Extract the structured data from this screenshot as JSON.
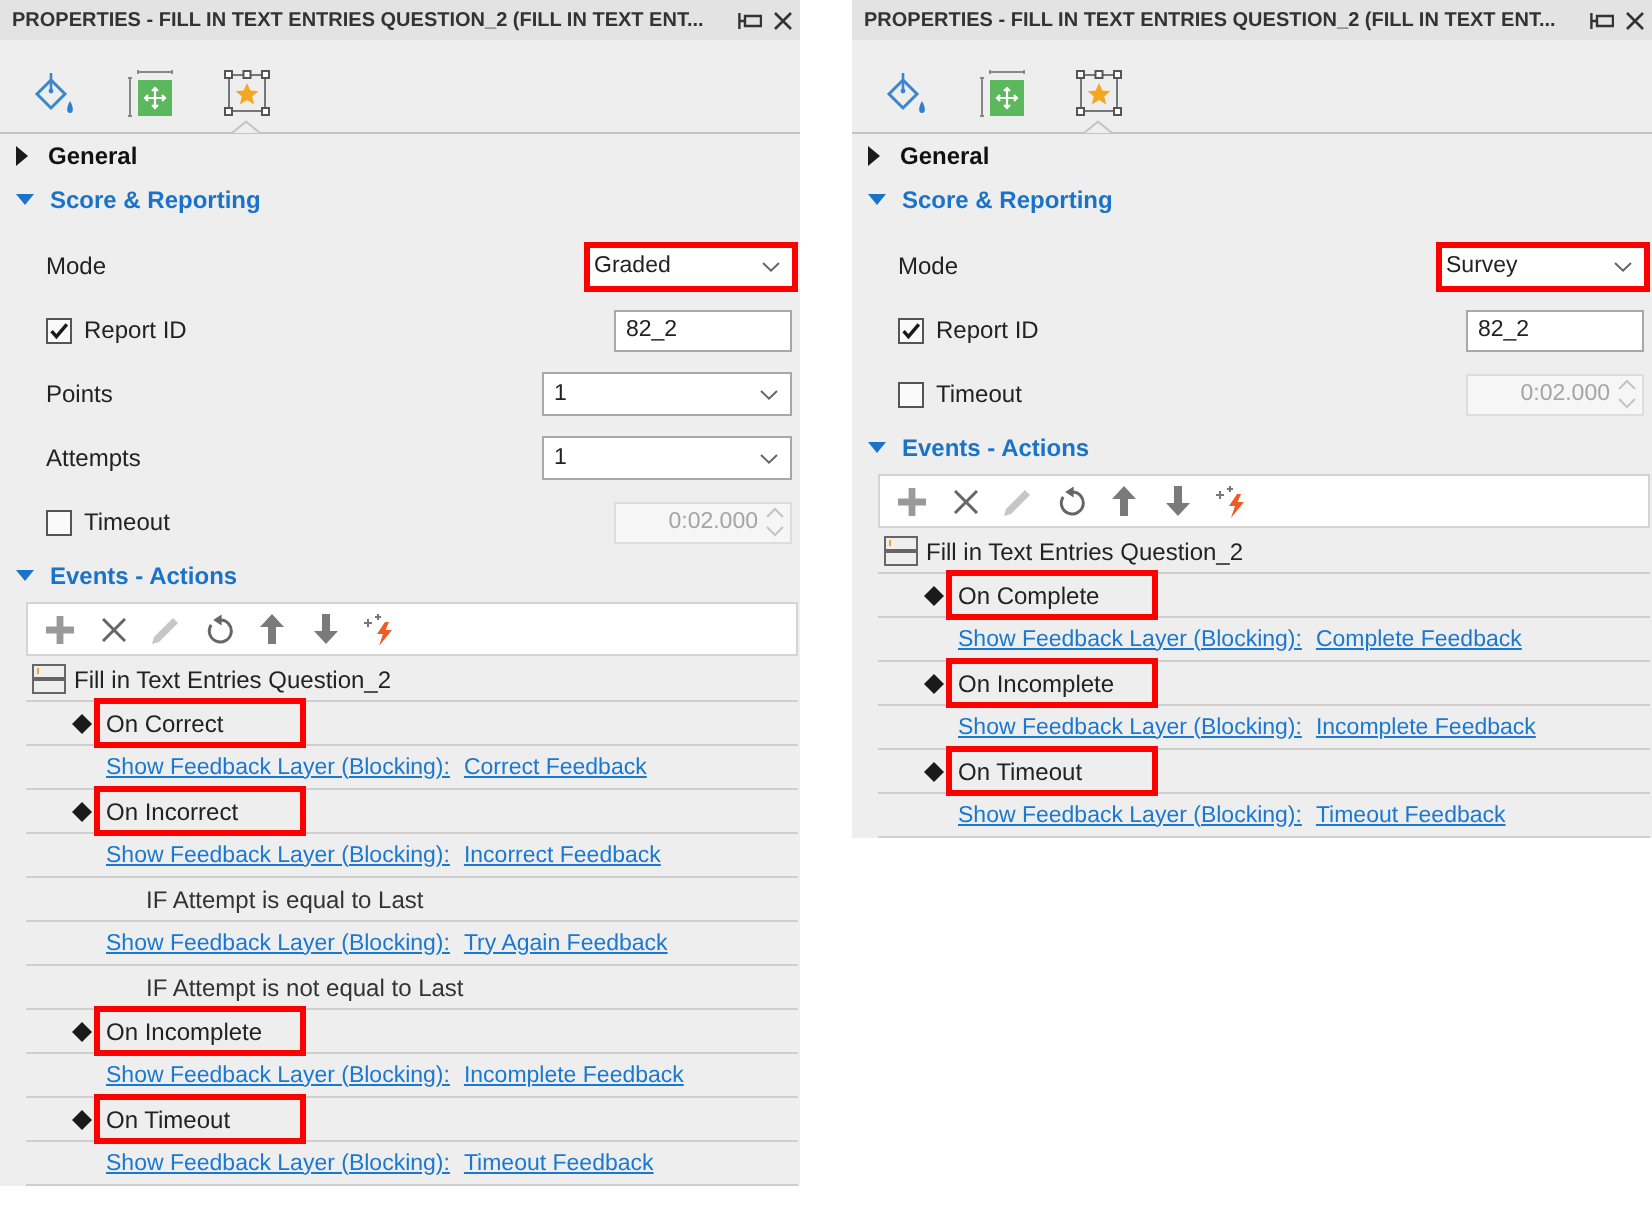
{
  "panels": [
    {
      "title": "PROPERTIES - FILL IN TEXT ENTRIES QUESTION_2 (FILL IN TEXT ENT...",
      "tabs": [
        {
          "kind": "fill",
          "selected": false
        },
        {
          "kind": "position",
          "selected": false
        },
        {
          "kind": "interaction",
          "selected": true
        }
      ],
      "sections": [
        {
          "title": "General",
          "expanded": false
        },
        {
          "title": "Score & Reporting",
          "expanded": true,
          "fields": [
            {
              "kind": "select",
              "label": "Mode",
              "value": "Graded",
              "highlighted": true
            },
            {
              "kind": "text",
              "label": "Report ID",
              "checked": true,
              "value": "82_2"
            },
            {
              "kind": "select",
              "label": "Points",
              "value": "1",
              "highlighted": false
            },
            {
              "kind": "select",
              "label": "Attempts",
              "value": "1",
              "highlighted": false
            },
            {
              "kind": "spinner",
              "label": "Timeout",
              "checked": false,
              "value": "0:02.000",
              "disabled": true
            }
          ]
        },
        {
          "title": "Events - Actions",
          "expanded": true,
          "toolbar": [
            {
              "kind": "add",
              "disabled": false
            },
            {
              "kind": "delete",
              "disabled": false
            },
            {
              "kind": "edit",
              "disabled": true
            },
            {
              "kind": "reset",
              "disabled": false
            },
            {
              "kind": "up",
              "disabled": false
            },
            {
              "kind": "down",
              "disabled": false
            },
            {
              "kind": "trigger",
              "disabled": false
            }
          ],
          "tree": {
            "label": "Fill in Text Entries Question_2",
            "children": [
              {
                "kind": "event",
                "label": "On Correct",
                "highlighted": true,
                "children": [
                  {
                    "kind": "action",
                    "action": "Show Feedback Layer (Blocking):",
                    "target": "Correct Feedback"
                  }
                ]
              },
              {
                "kind": "event",
                "label": "On Incorrect",
                "highlighted": true,
                "children": [
                  {
                    "kind": "action",
                    "action": "Show Feedback Layer (Blocking):",
                    "target": "Incorrect Feedback",
                    "children": [
                      {
                        "kind": "condition",
                        "label": "IF Attempt is equal to Last"
                      }
                    ]
                  },
                  {
                    "kind": "action",
                    "action": "Show Feedback Layer (Blocking):",
                    "target": "Try Again Feedback",
                    "children": [
                      {
                        "kind": "condition",
                        "label": "IF Attempt is not equal to Last"
                      }
                    ]
                  }
                ]
              },
              {
                "kind": "event",
                "label": "On Incomplete",
                "highlighted": true,
                "children": [
                  {
                    "kind": "action",
                    "action": "Show Feedback Layer (Blocking):",
                    "target": "Incomplete Feedback"
                  }
                ]
              },
              {
                "kind": "event",
                "label": "On Timeout",
                "highlighted": true,
                "children": [
                  {
                    "kind": "action",
                    "action": "Show Feedback Layer (Blocking):",
                    "target": "Timeout Feedback"
                  }
                ]
              }
            ]
          }
        }
      ]
    },
    {
      "title": "PROPERTIES - FILL IN TEXT ENTRIES QUESTION_2 (FILL IN TEXT ENT...",
      "tabs": [
        {
          "kind": "fill",
          "selected": false
        },
        {
          "kind": "position",
          "selected": false
        },
        {
          "kind": "interaction",
          "selected": true
        }
      ],
      "sections": [
        {
          "title": "General",
          "expanded": false
        },
        {
          "title": "Score & Reporting",
          "expanded": true,
          "fields": [
            {
              "kind": "select",
              "label": "Mode",
              "value": "Survey",
              "highlighted": true
            },
            {
              "kind": "text",
              "label": "Report ID",
              "checked": true,
              "value": "82_2"
            },
            {
              "kind": "spinner",
              "label": "Timeout",
              "checked": false,
              "value": "0:02.000",
              "disabled": true
            }
          ]
        },
        {
          "title": "Events - Actions",
          "expanded": true,
          "toolbar": [
            {
              "kind": "add",
              "disabled": false
            },
            {
              "kind": "delete",
              "disabled": false
            },
            {
              "kind": "edit",
              "disabled": true
            },
            {
              "kind": "reset",
              "disabled": false
            },
            {
              "kind": "up",
              "disabled": false
            },
            {
              "kind": "down",
              "disabled": false
            },
            {
              "kind": "trigger",
              "disabled": false
            }
          ],
          "tree": {
            "label": "Fill in Text Entries Question_2",
            "children": [
              {
                "kind": "event",
                "label": "On Complete",
                "highlighted": true,
                "children": [
                  {
                    "kind": "action",
                    "action": "Show Feedback Layer (Blocking):",
                    "target": "Complete Feedback"
                  }
                ]
              },
              {
                "kind": "event",
                "label": "On Incomplete",
                "highlighted": true,
                "children": [
                  {
                    "kind": "action",
                    "action": "Show Feedback Layer (Blocking):",
                    "target": "Incomplete Feedback"
                  }
                ]
              },
              {
                "kind": "event",
                "label": "On Timeout",
                "highlighted": true,
                "children": [
                  {
                    "kind": "action",
                    "action": "Show Feedback Layer (Blocking):",
                    "target": "Timeout Feedback"
                  }
                ]
              }
            ]
          }
        }
      ]
    }
  ]
}
